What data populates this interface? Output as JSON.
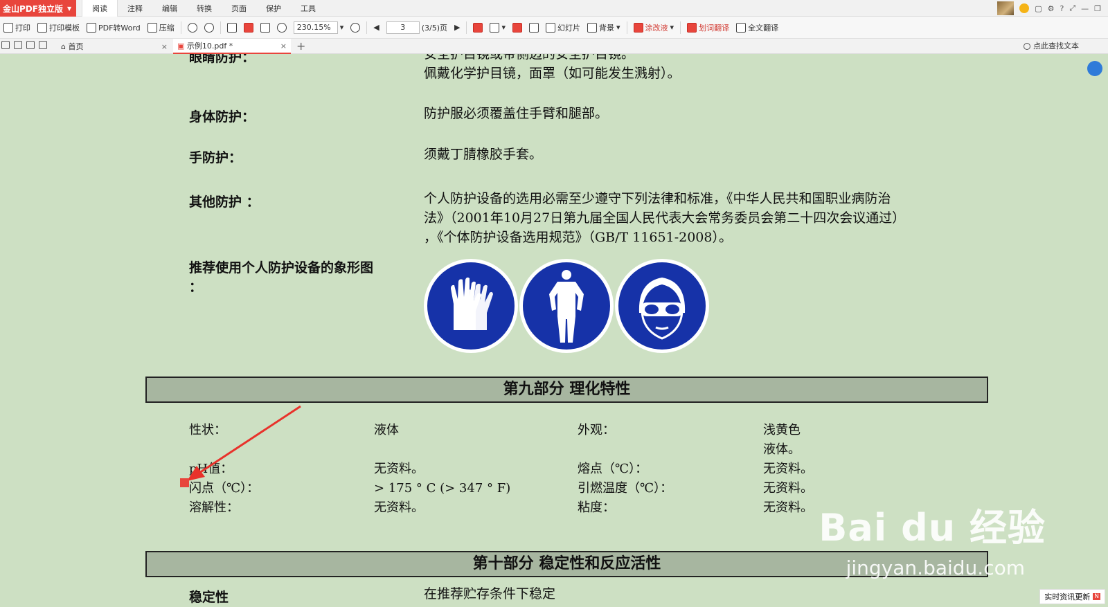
{
  "app": {
    "brand": "金山PDF独立版"
  },
  "menu": [
    "阅读",
    "注释",
    "编辑",
    "转换",
    "页面",
    "保护",
    "工具"
  ],
  "toolbar": {
    "print": "打印",
    "print_template": "打印模板",
    "pdf_to_word": "PDF转Word",
    "compress": "压缩",
    "zoom": "230.15%",
    "page_input": "3",
    "page_count": "(3/5)页",
    "slideshow": "幻灯片",
    "background": "背景",
    "correction": "涂改液",
    "word_translate": "划词翻译",
    "full_translate": "全文翻译"
  },
  "tabs": {
    "home": "首页",
    "doc": "示例10.pdf *",
    "search": "点此查找文本"
  },
  "doc": {
    "eye_label": "眼睛防护：",
    "eye_value_1": "安全护目镜或带侧边的安全护目镜。",
    "eye_value_2": "佩戴化学护目镜，面罩（如可能发生溅射）。",
    "body_label": "身体防护：",
    "body_value": "防护服必须覆盖住手臂和腿部。",
    "hand_label": "手防护：",
    "hand_value": "须戴丁腈橡胶手套。",
    "other_label": "其他防护 ：",
    "other_value_1": "个人防护设备的选用必需至少遵守下列法律和标准，《中华人民共和国职业病防治",
    "other_value_2": "法》（2001年10月27日第九届全国人民代表大会常务委员会第二十四次会议通过）",
    "other_value_3": "，《个体防护设备选用规范》（GB/T 11651-2008）。",
    "picto_label_1": "推荐使用个人防护设备的象形图",
    "picto_label_2": "：",
    "section9": "第九部分  理化特性",
    "props": {
      "state_label": "性状：",
      "state_value": "液体",
      "appearance_label": "外观：",
      "appearance_value_1": "浅黄色",
      "appearance_value_2": "液体。",
      "ph_label": "pH值：",
      "ph_value": "无资料。",
      "melt_label": "熔点（℃）：",
      "melt_value": "无资料。",
      "flash_label": "闪点（℃）：",
      "flash_value": "> 175 ° C (> 347 ° F)",
      "ignite_label": "引燃温度（℃）：",
      "ignite_value": "无资料。",
      "sol_label": "溶解性：",
      "sol_value": "无资料。",
      "visc_label": "粘度：",
      "visc_value": "无资料。"
    },
    "section10": "第十部分  稳定性和反应活性",
    "stability_label": "稳定性",
    "stability_value": "在推荐贮存条件下稳定"
  },
  "watermark": {
    "logo": "Bai du 经验",
    "url": "jingyan.baidu.com"
  },
  "news": {
    "text": "实时资讯更新",
    "badge": "N"
  },
  "colors": {
    "accent": "#e8453c",
    "page_bg": "#cde0c3",
    "picto_blue": "#1632a8",
    "section_bg": "#a7b6a0"
  }
}
